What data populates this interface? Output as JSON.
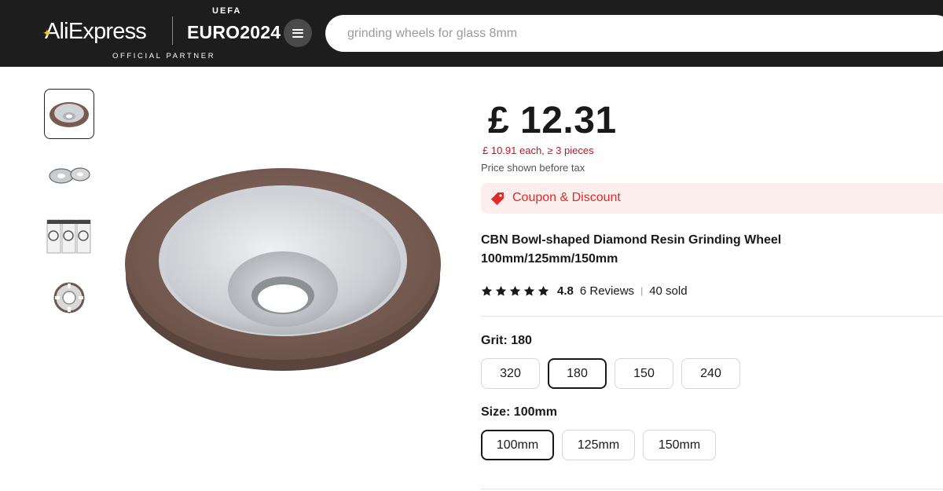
{
  "header": {
    "logo_text": "AliExpress",
    "partner_logo": "EURO2024",
    "partner_badge": "UEFA",
    "partner_caption": "OFFICIAL PARTNER",
    "menu_icon": "hamburger-icon",
    "search": {
      "placeholder": "grinding wheels for glass 8mm"
    }
  },
  "gallery": {
    "thumbnails": [
      "bowl-wheel-front",
      "bowl-wheels-pair",
      "wheel-packages",
      "wheel-top-view"
    ],
    "active_index": 0
  },
  "product": {
    "price": "£ 12.31",
    "bulk_price": "£ 10.91 each, ≥ 3 pieces",
    "tax_note": "Price shown before tax",
    "coupon_label": "Coupon & Discount",
    "title": "CBN Bowl-shaped Diamond Resin Grinding Wheel 100mm/125mm/150mm",
    "rating": "4.8",
    "stars": 5,
    "reviews": "6 Reviews",
    "sold": "40 sold"
  },
  "options": {
    "grit": {
      "label": "Grit: ",
      "selected": "180",
      "values": [
        "320",
        "180",
        "150",
        "240"
      ]
    },
    "size": {
      "label": "Size: ",
      "selected": "100mm",
      "values": [
        "100mm",
        "125mm",
        "150mm"
      ]
    }
  },
  "colors": {
    "header_bg": "#1d1d1d",
    "accent_red": "#e02b27",
    "price_red": "#c7131e",
    "logo_star": "#f5c400"
  }
}
